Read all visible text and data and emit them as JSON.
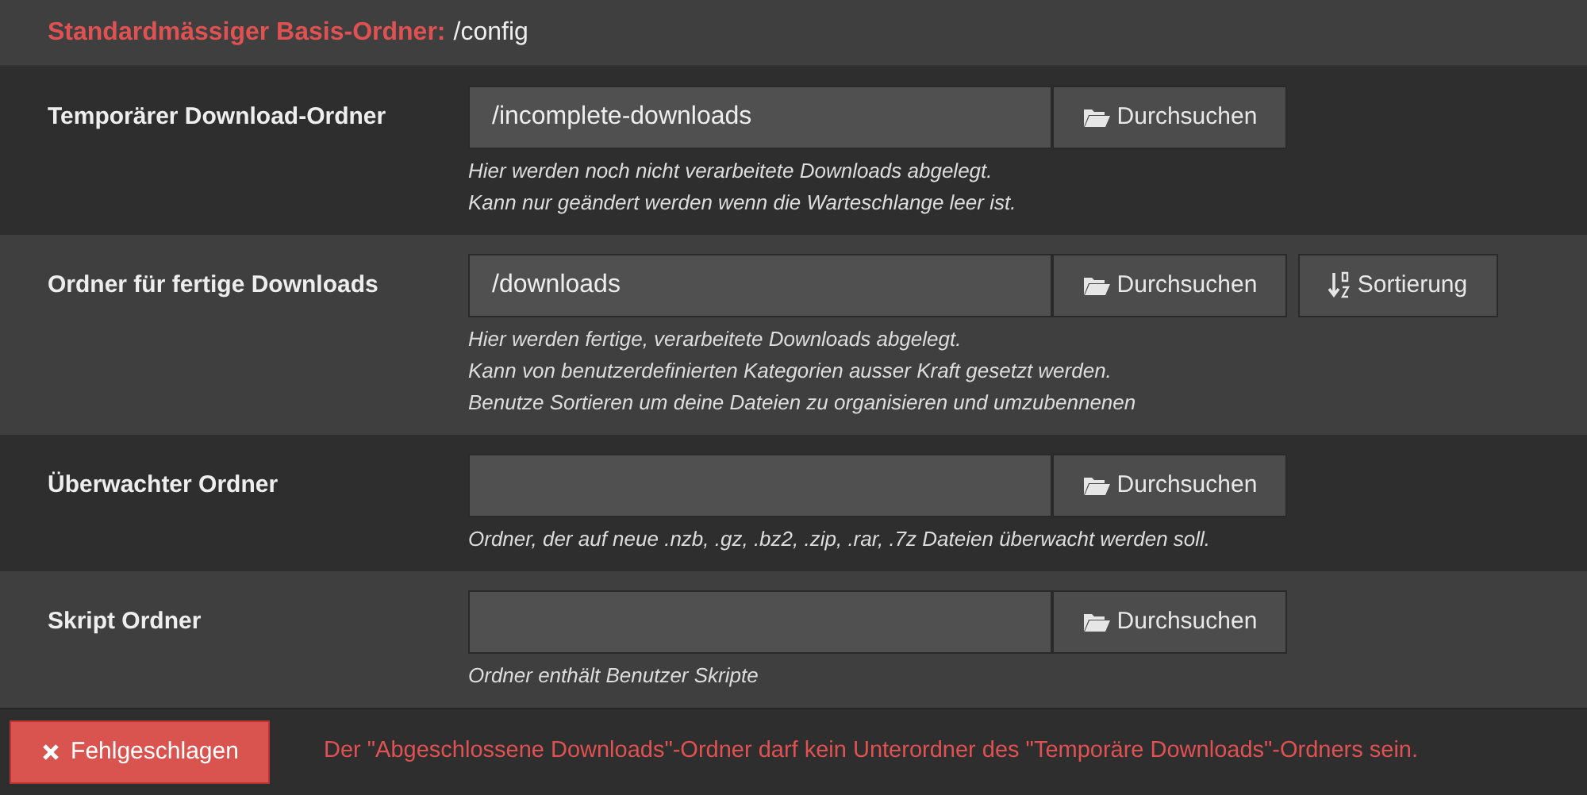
{
  "header": {
    "label": "Standardmässiger Basis-Ordner:",
    "value": "/config"
  },
  "rows": [
    {
      "label": "Temporärer Download-Ordner",
      "value": "/incomplete-downloads",
      "buttons": [
        {
          "kind": "browse",
          "label": "Durchsuchen"
        }
      ],
      "help": [
        "Hier werden noch nicht verarbeitete Downloads abgelegt.",
        "Kann nur geändert werden wenn die Warteschlange leer ist."
      ]
    },
    {
      "label": "Ordner für fertige Downloads",
      "value": "/downloads",
      "buttons": [
        {
          "kind": "browse",
          "label": "Durchsuchen"
        },
        {
          "kind": "sort",
          "label": "Sortierung"
        }
      ],
      "help": [
        "Hier werden fertige, verarbeitete Downloads abgelegt.",
        "Kann von benutzerdefinierten Kategorien ausser Kraft gesetzt werden.",
        "Benutze Sortieren um deine Dateien zu organisieren und umzubennenen"
      ]
    },
    {
      "label": "Überwachter Ordner",
      "buttons": [
        {
          "kind": "browse",
          "label": "Durchsuchen"
        }
      ],
      "help": [
        "Ordner, der auf neue .nzb, .gz, .bz2, .zip, .rar, .7z Dateien überwacht werden soll."
      ]
    },
    {
      "label": "Skript Ordner",
      "buttons": [
        {
          "kind": "browse",
          "label": "Durchsuchen"
        }
      ],
      "help": [
        "Ordner enthält Benutzer Skripte"
      ]
    }
  ],
  "footer": {
    "status_button": "Fehlgeschlagen",
    "message": "Der \"Abgeschlossene Downloads\"-Ordner darf kein Unterordner des \"Temporäre Downloads\"-Ordners sein."
  }
}
